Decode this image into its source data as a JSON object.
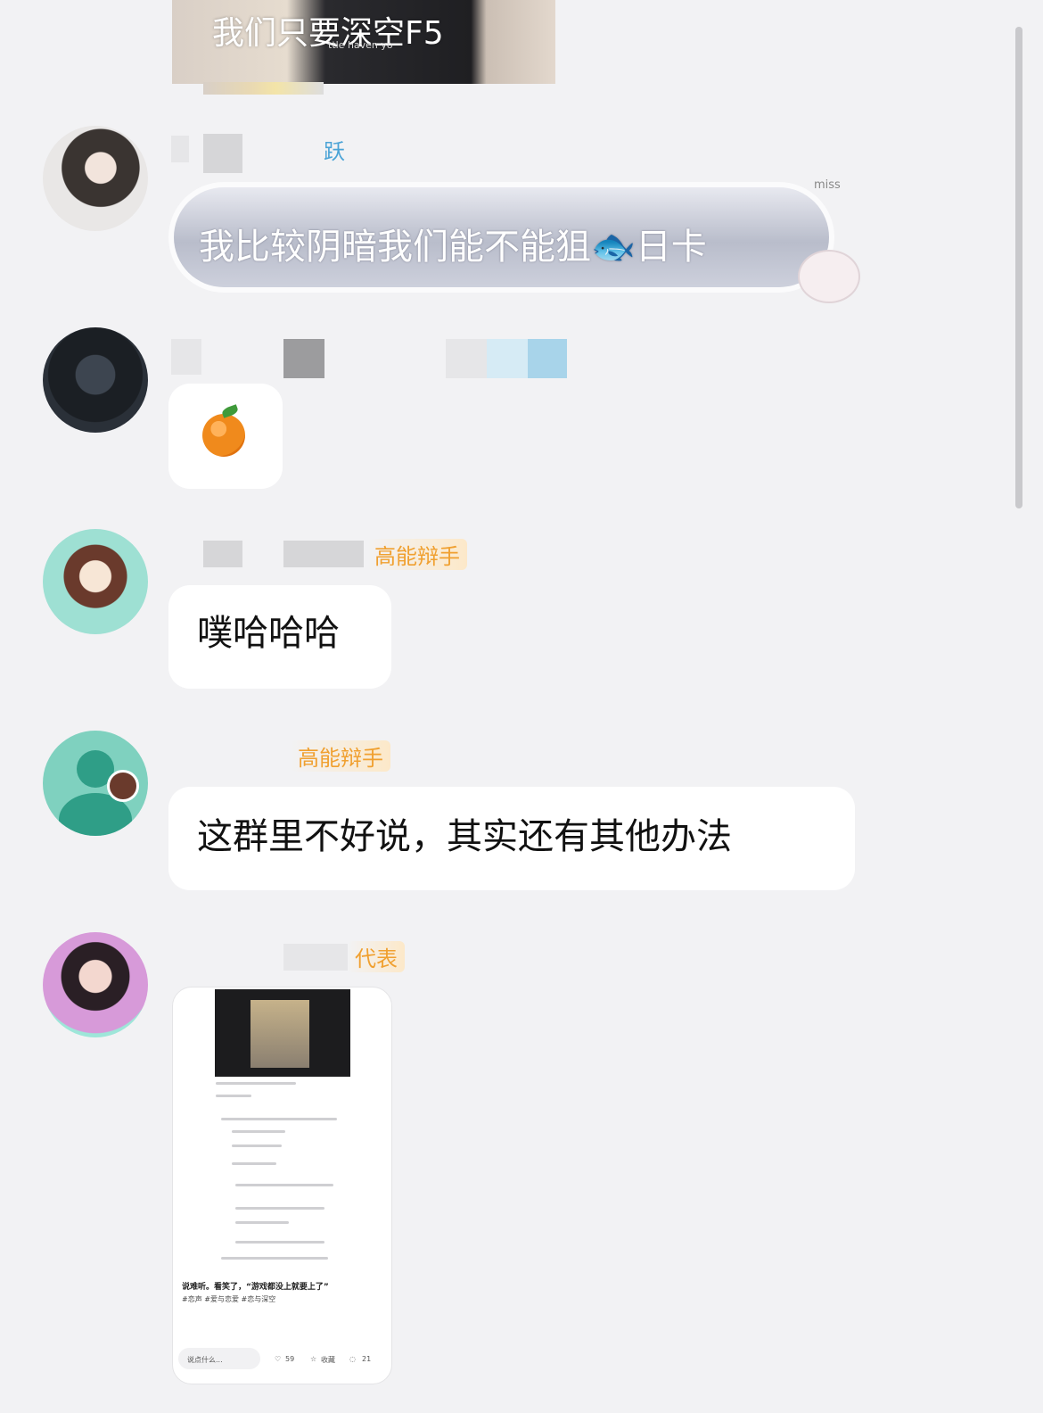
{
  "top_image": {
    "caption": "我们只要深空F5",
    "subcaption": "ttle haven yo"
  },
  "messages": [
    {
      "name_badge": "跃",
      "text": "我比较阴暗我们能不能狙",
      "emoji": "🐟",
      "text_after": "日卡",
      "sticker_label": "miss"
    },
    {
      "content_icon": "orange"
    },
    {
      "name_badge": "高能辩手",
      "text": "噗哈哈哈"
    },
    {
      "name_badge": "高能辩手",
      "text": "这群里不好说，其实还有其他办法"
    },
    {
      "name_badge": "代表",
      "screenshot": {
        "caption": "说难听。看笑了，“游戏都没上就要上了”",
        "tags": "#恋声 #爱与恋爱 #恋与深空",
        "likes": "59",
        "fav_label": "收藏",
        "comments": "21",
        "reply_placeholder": "说点什么..."
      }
    }
  ]
}
